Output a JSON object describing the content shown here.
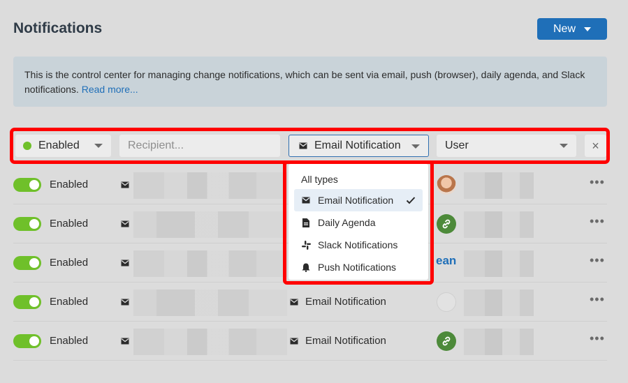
{
  "header": {
    "title": "Notifications",
    "new_label": "New"
  },
  "info": {
    "text": "This is the control center for managing change notifications, which can be sent via email, push (browser), daily agenda, and Slack notifications.",
    "link": "Read more..."
  },
  "filters": {
    "status": "Enabled",
    "recipient_placeholder": "Recipient...",
    "type": "Email Notification",
    "user": "User",
    "clear": "×"
  },
  "dropdown": {
    "header": "All types",
    "items": [
      "Email Notification",
      "Daily Agenda",
      "Slack Notifications",
      "Push Notifications"
    ],
    "selected": "Email Notification"
  },
  "rows": [
    {
      "status": "Enabled",
      "type": "",
      "avatar": "photo"
    },
    {
      "status": "Enabled",
      "type": "",
      "avatar": "link"
    },
    {
      "status": "Enabled",
      "type": "",
      "avatar": "text",
      "avatar_text": "ean"
    },
    {
      "status": "Enabled",
      "type": "Email Notification",
      "avatar": "blank"
    },
    {
      "status": "Enabled",
      "type": "Email Notification",
      "avatar": "link"
    }
  ],
  "colors": {
    "accent": "#1f6fb8",
    "enabled_green": "#6fc02a",
    "highlight": "#ff0000"
  }
}
